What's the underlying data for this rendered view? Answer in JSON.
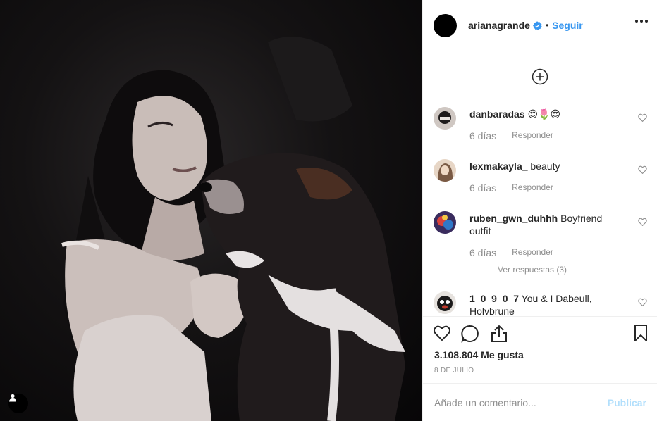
{
  "post": {
    "author": {
      "username": "arianagrande",
      "dot": "•",
      "follow_label": "Seguir"
    }
  },
  "comments": [
    {
      "username": "danbaradas",
      "text": "😍🌷😍",
      "time": "6 días",
      "reply_label": "Responder"
    },
    {
      "username": "lexmakayla_",
      "text": "beauty",
      "time": "6 días",
      "reply_label": "Responder"
    },
    {
      "username": "ruben_gwn_duhhh",
      "text": "Boyfriend outfit",
      "time": "6 días",
      "reply_label": "Responder",
      "view_replies": "Ver respuestas (3)"
    },
    {
      "username": "1_0_9_0_7",
      "text": "You & I Dabeull, Holybrune"
    }
  ],
  "engagement": {
    "likes": "3.108.804 Me gusta",
    "date": "8 DE JULIO"
  },
  "comment_box": {
    "placeholder": "Añade un comentario...",
    "publish_label": "Publicar"
  },
  "colors": {
    "accent": "#3897f0",
    "publish_disabled": "#b2dffc",
    "muted": "#8e8e8e"
  },
  "icons": {
    "verified": "verified-badge-icon",
    "more": "more-options-icon",
    "load_more": "plus-circle-icon",
    "like": "heart-icon",
    "comment": "speech-bubble-icon",
    "share": "share-icon",
    "save": "bookmark-icon",
    "tag": "user-tag-icon"
  }
}
